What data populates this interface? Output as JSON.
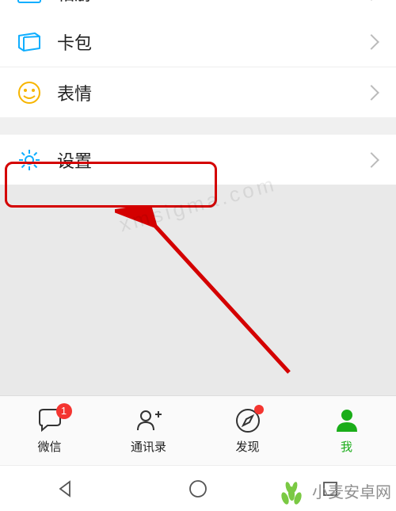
{
  "colors": {
    "accent": "#1aad19",
    "badge": "#f43530",
    "icon_blue": "#10AEFF",
    "icon_orange": "#F7B500",
    "icon_gear": "#10AEFF"
  },
  "menu": {
    "album": {
      "label": "相册"
    },
    "card": {
      "label": "卡包"
    },
    "sticker": {
      "label": "表情"
    },
    "settings": {
      "label": "设置"
    }
  },
  "tabs": {
    "chat": {
      "label": "微信",
      "badge": "1"
    },
    "contacts": {
      "label": "通讯录"
    },
    "discover": {
      "label": "发现",
      "dot": true
    },
    "me": {
      "label": "我"
    }
  },
  "watermark": {
    "center": "xmsigma.com",
    "corner": "小麦安卓网"
  }
}
